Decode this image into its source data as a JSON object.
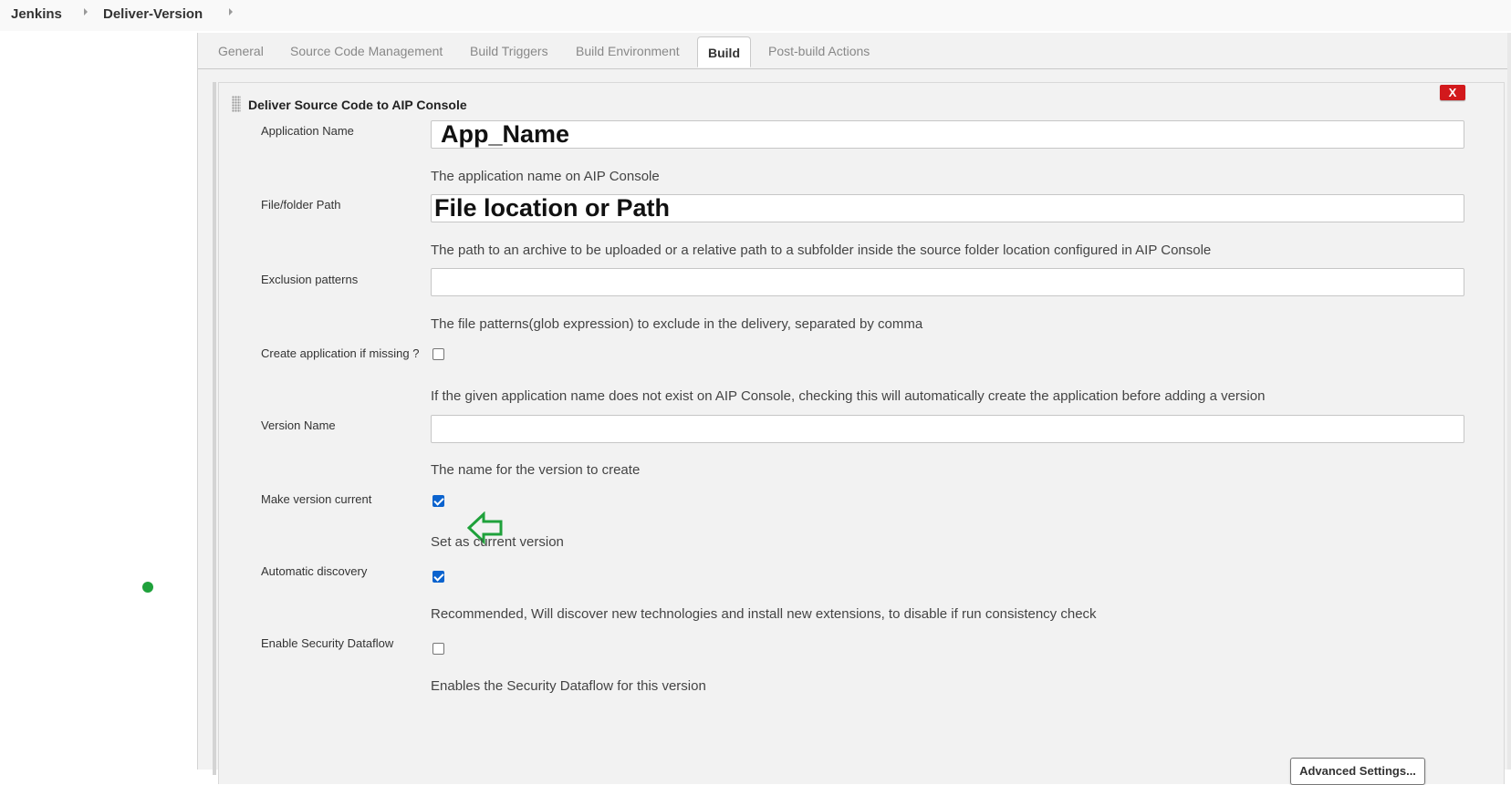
{
  "breadcrumb": {
    "items": [
      "Jenkins",
      "Deliver-Version"
    ]
  },
  "tabs": [
    "General",
    "Source Code Management",
    "Build Triggers",
    "Build Environment",
    "Build",
    "Post-build Actions"
  ],
  "active_tab": "Build",
  "step": {
    "title": "Deliver Source Code to AIP Console",
    "delete_label": "X",
    "fields": {
      "application_name": {
        "label": "Application Name",
        "value": "App_Name",
        "help": "The application name on AIP Console"
      },
      "file_path": {
        "label": "File/folder Path",
        "value": "File location or Path",
        "help": "The path to an archive to be uploaded or a relative path to a subfolder inside the source folder location configured in AIP Console"
      },
      "exclusion_patterns": {
        "label": "Exclusion patterns",
        "value": "",
        "help": "The file patterns(glob expression) to exclude in the delivery, separated by comma"
      },
      "create_application": {
        "label": "Create application if missing ?",
        "checked": false,
        "help": "If the given application name does not exist on AIP Console, checking this will automatically create the application before adding a version"
      },
      "version_name": {
        "label": "Version Name",
        "value": "",
        "help": "The name for the version to create"
      },
      "make_current": {
        "label": "Make version current",
        "checked": true,
        "help": "Set as current version"
      },
      "auto_discovery": {
        "label": "Automatic discovery",
        "checked": true,
        "help": "Recommended, Will discover new technologies and install new extensions, to disable if run consistency check"
      },
      "security_dataflow": {
        "label": "Enable Security Dataflow",
        "checked": false,
        "help": "Enables the Security Dataflow for this version"
      }
    },
    "advanced_button": "Advanced Settings..."
  },
  "colors": {
    "delete_button": "#d2191c",
    "annotation_arrow": "#1fa13b",
    "checkbox_checked": "#0b63ce",
    "panel_background": "#f2f2f2"
  }
}
